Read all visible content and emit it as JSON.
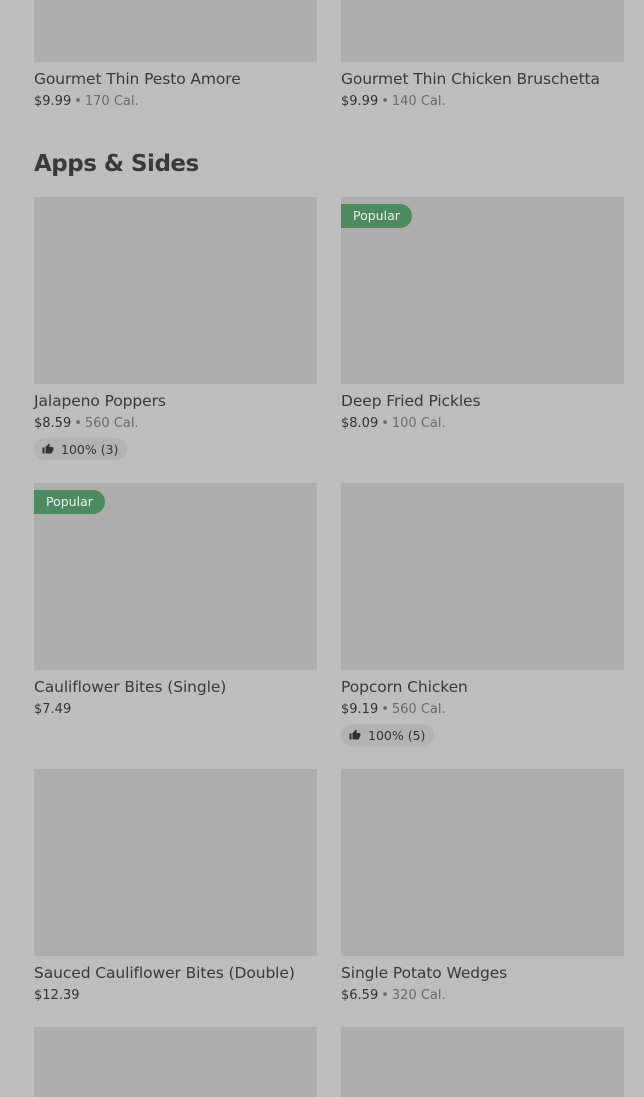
{
  "top_items": [
    {
      "name": "Gourmet Thin Pesto Amore",
      "price": "$9.99",
      "calories": "170 Cal."
    },
    {
      "name": "Gourmet Thin Chicken Bruschetta",
      "price": "$9.99",
      "calories": "140 Cal."
    }
  ],
  "section": {
    "title": "Apps & Sides"
  },
  "items": [
    {
      "name": "Jalapeno Poppers",
      "price": "$8.59",
      "calories": "560 Cal.",
      "rating": "100% (3)"
    },
    {
      "name": "Deep Fried Pickles",
      "price": "$8.09",
      "calories": "100 Cal.",
      "badge": "Popular"
    },
    {
      "name": "Cauliflower Bites (Single)",
      "price": "$7.49",
      "badge": "Popular"
    },
    {
      "name": "Popcorn Chicken",
      "price": "$9.19",
      "calories": "560 Cal.",
      "rating": "100% (5)"
    },
    {
      "name": "Sauced Cauliflower Bites (Double)",
      "price": "$12.39"
    },
    {
      "name": "Single Potato Wedges",
      "price": "$6.59",
      "calories": "320 Cal."
    }
  ],
  "separator": "•",
  "icons": {
    "rating": "thumbs-up-icon"
  },
  "colors": {
    "background": "#bdbdbd",
    "image_placeholder": "#adadad",
    "badge": "#4e8a5f",
    "rating_pill": "#b2b2b2"
  }
}
